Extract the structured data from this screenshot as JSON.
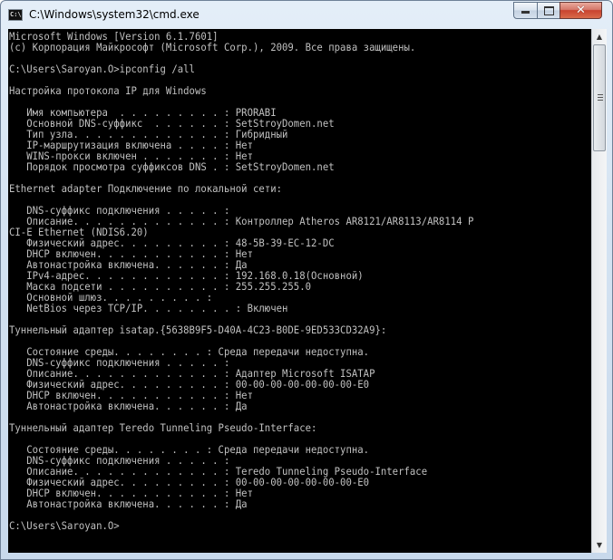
{
  "window": {
    "title": "C:\\Windows\\system32\\cmd.exe",
    "icon_label": "C:\\"
  },
  "controls": {
    "minimize": "minimize-icon",
    "maximize": "maximize-icon",
    "close": "close-icon"
  },
  "console": {
    "lines": [
      "Microsoft Windows [Version 6.1.7601]",
      "(с) Корпорация Майкрософт (Microsoft Corp.), 2009. Все права защищены.",
      "",
      "C:\\Users\\Saroyan.O>ipconfig /all",
      "",
      "Настройка протокола IP для Windows",
      "",
      "   Имя компьютера  . . . . . . . . . : PRORABI",
      "   Основной DNS-суффикс  . . . . . . : SetStroyDomen.net",
      "   Тип узла. . . . . . . . . . . . . : Гибридный",
      "   IP-маршрутизация включена . . . . : Нет",
      "   WINS-прокси включен . . . . . . . : Нет",
      "   Порядок просмотра суффиксов DNS . : SetStroyDomen.net",
      "",
      "Ethernet adapter Подключение по локальной сети:",
      "",
      "   DNS-суффикс подключения . . . . . :",
      "   Описание. . . . . . . . . . . . . : Контроллер Atheros AR8121/AR8113/AR8114 P",
      "CI-E Ethernet (NDIS6.20)",
      "   Физический адрес. . . . . . . . . : 48-5B-39-EC-12-DC",
      "   DHCP включен. . . . . . . . . . . : Нет",
      "   Автонастройка включена. . . . . . : Да",
      "   IPv4-адрес. . . . . . . . . . . . : 192.168.0.18(Основной)",
      "   Маска подсети . . . . . . . . . . : 255.255.255.0",
      "   Основной шлюз. . . . . . . . . :",
      "   NetBios через TCP/IP. . . . . . . . : Включен",
      "",
      "Туннельный адаптер isatap.{5638B9F5-D40A-4C23-B0DE-9ED533CD32A9}:",
      "",
      "   Состояние среды. . . . . . . . : Среда передачи недоступна.",
      "   DNS-суффикс подключения . . . . . :",
      "   Описание. . . . . . . . . . . . . : Адаптер Microsoft ISATAP",
      "   Физический адрес. . . . . . . . . : 00-00-00-00-00-00-00-E0",
      "   DHCP включен. . . . . . . . . . . : Нет",
      "   Автонастройка включена. . . . . . : Да",
      "",
      "Туннельный адаптер Teredo Tunneling Pseudo-Interface:",
      "",
      "   Состояние среды. . . . . . . . : Среда передачи недоступна.",
      "   DNS-суффикс подключения . . . . . :",
      "   Описание. . . . . . . . . . . . . : Teredo Tunneling Pseudo-Interface",
      "   Физический адрес. . . . . . . . . : 00-00-00-00-00-00-00-E0",
      "   DHCP включен. . . . . . . . . . . : Нет",
      "   Автонастройка включена. . . . . . : Да",
      "",
      "C:\\Users\\Saroyan.O>"
    ]
  },
  "scrollbar": {
    "up_arrow": "▲",
    "down_arrow": "▼"
  }
}
